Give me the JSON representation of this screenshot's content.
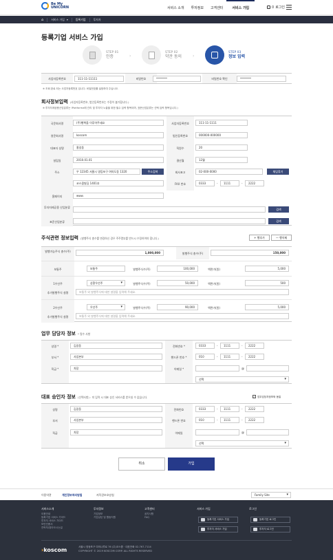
{
  "header": {
    "logo_line1": "Be My",
    "logo_line2": "UNICORN",
    "nav": [
      "서비스 소개",
      "투자정보",
      "고객센터",
      "서비스 가입"
    ],
    "cart_label": "로그인",
    "cart_count": "0"
  },
  "breadcrumb": [
    "서비스 가입",
    "등록기업",
    "투자자"
  ],
  "page_title": "등록기업 서비스 가입",
  "steps": [
    {
      "num": "STEP 01",
      "label": "인증"
    },
    {
      "num": "STEP 02",
      "label": "약관 동의"
    },
    {
      "num": "STEP 03",
      "label": "정보 입력"
    }
  ],
  "account": {
    "bizno_label": "사업자등록번호",
    "bizno_value": "111-11-11111",
    "pw_label": "비밀번호",
    "pw_value": "********",
    "pw2_label": "비밀번호 확인",
    "pw2_value": "********",
    "note": "※ 조회 완료 되는 사업자등록번호 입니다. 비밀번호를 설정하여 주십시오."
  },
  "company": {
    "title": "회사정보입력",
    "subtitle": "(사업자등록번호, 법인등록번호는 수정이 불가합니다.)",
    "note": "※ 투자자제공용산업분류는 IPartforma에 관리 및 투자자 노출을 위한 필수 입력 항목이며, 표준산업분류는 선택 입력 항목입니다.)",
    "name_label": "국문회사명",
    "name_value": "(주)행복을 이루어주세요",
    "bizno_label": "사업자등록번호",
    "bizno_value": "111-11-1111",
    "en_label": "영문회사명",
    "en_value": "koscom",
    "corpno_label": "법인등록번호",
    "corpno_value": "000000-000000",
    "ceo_label": "대표자 성명",
    "ceo_value": "홍길동",
    "emp_label": "직원수",
    "emp_value": "20",
    "est_label": "설립일",
    "est_value": "2010.01.01",
    "fiscal_label": "결산월",
    "fiscal_value": "12월",
    "addr_label": "주소",
    "addr_value": "우 12345  서울시 영등포구 여의도동 1320",
    "addr_btn": "주소검색",
    "tel_label": "회사표고",
    "tel_value": "02-000-0000",
    "tel_btn": "채임찾기",
    "addr2_value": "코스콤빌딩 1401호",
    "fax_label": "FAX 번호",
    "fax": [
      "0333",
      "1111",
      "2222"
    ],
    "home_label": "홈페이지",
    "home_value": "www.",
    "inv_label": "투자자제공용 산업분류",
    "inv_btn": "검색",
    "std_label": "표준산업분류",
    "std_btn": "검색"
  },
  "stock": {
    "title": "주식관련 정보입력",
    "subtitle": "(발행주식 총수를 변경하신 경우 주주명부를 반드시 수정하여야 합니다.)",
    "add_btn": "+ 행추가",
    "del_btn": "— 행삭제",
    "issuable_label": "발행가능주식 총수(주)",
    "issuable_value": "1,000,000",
    "issued_label": "발행주식 총수(주)",
    "issued_value": "150,000",
    "rows": [
      {
        "kind_label": "보통주",
        "kind_value": "보통주",
        "cnt_label": "발행주식수(주)",
        "cnt_value": "100,000",
        "par_label": "액면가(원)",
        "par_value": "5,000",
        "note_label": "",
        "note_value": ""
      },
      {
        "kind_label": "1우선주",
        "kind_value": "상환우선주",
        "cnt_label": "발행주식수(주)",
        "cnt_value": "50,000",
        "par_label": "액면가(원)",
        "par_value": "500",
        "note_label": "추가발행주식 설명",
        "note_value": "보통주 외 발행주식에 대한 설명을 입력해 주세요."
      },
      {
        "kind_label": "2우선주",
        "kind_value": "우선주",
        "cnt_label": "발행주식수(주)",
        "cnt_value": "90,000",
        "par_label": "액면가(원)",
        "par_value": "5,000",
        "note_label": "추가발행주식 설명",
        "note_value": "보통주 외 발행주식에 대한 설명을 입력해 주세요."
      }
    ]
  },
  "manager": {
    "title": "업무 담당자 정보",
    "subtitle": "* 필수 사항",
    "name_label": "성명 *",
    "name_value": "김길동",
    "phone_label": "전화번호 *",
    "phone": [
      "0333",
      "1111",
      "2222"
    ],
    "dept_label": "부서 *",
    "dept_value": "사업본부",
    "mobile_label": "핸드폰 번호 *",
    "mobile": [
      "010",
      "1111",
      "2222"
    ],
    "pos_label": "직급 *",
    "pos_value": "차장",
    "email_label": "이메일 *",
    "email_at": "@",
    "email_select": "선택"
  },
  "approver": {
    "title": "대표 승인자 정보",
    "subtitle": "(선택사항) : 미 입력 시 대표 승인 서비스를 받으실 수 없습니다.",
    "same_label": "업무담당자정보와 동일",
    "name_label": "성명",
    "name_value": "김길동",
    "phone_label": "전화번호",
    "phone": [
      "0333",
      "1111",
      "2222"
    ],
    "dept_label": "부서",
    "dept_value": "사업본부",
    "mobile_label": "핸드폰 번호",
    "mobile": [
      "010",
      "1111",
      "2222"
    ],
    "pos_label": "직급",
    "pos_value": "차장",
    "email_label": "이메일",
    "email_at": "@",
    "email_select": "선택"
  },
  "actions": {
    "cancel": "취소",
    "join": "가입"
  },
  "footer_nav": {
    "links": [
      "이용약관",
      "개인정보처리방침",
      "저작권보호방침"
    ],
    "family": "Family Site"
  },
  "footer": {
    "col1_title": "서비스소개",
    "col1_items": [
      "이용안내",
      "등록기업 서비스 가이드",
      "투자자 서비스 가이드",
      "보안인증서",
      "연락처/찾아오시는길"
    ],
    "col2_title": "투자정보",
    "col2_items": [
      "기업정보",
      "기업상담 및 활동지원"
    ],
    "col3_title": "고객센터",
    "col3_items": [
      "공지사항",
      "FAQ"
    ],
    "col4_title": "서비스 가입",
    "col4_btns": [
      "등록기업 서비스 가입",
      "투자자 서비스 가입"
    ],
    "col5_title": "로그인",
    "col5_btns": [
      "등록기업 로그인",
      "투자자 로그인"
    ],
    "address": "서울시 영등포구 여의나루로 76 (주)코스콤  ·  대표전화 02-767-7114",
    "copyright": "COPYRIGHT © 2019 KOSCOM CORP. ALL RIGHTS RESERVED",
    "logo": "koscom"
  }
}
